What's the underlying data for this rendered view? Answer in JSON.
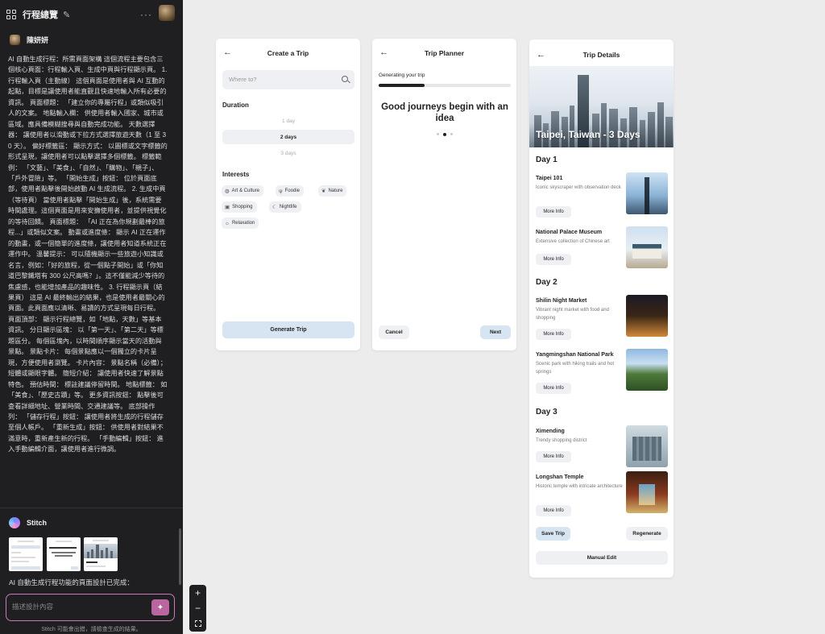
{
  "sidebar": {
    "project_title": "行程總覽",
    "user_name": "陳妍妍",
    "message": "AI 自動生成行程：所需頁面架構 這個流程主要包含三個核心頁面：行程輸入頁、生成中頁與行程顯示頁。 1. 行程輸入頁（主動線） 這個頁面是使用者與 AI 互動的起點，目標是讓使用者能直觀且快速地輸入所有必要的資訊。 頁面標題： 「建立你的專屬行程」或類似吸引人的文案。 地點輸入欄： 供使用者輸入國家、城市或區域。應具備模糊搜尋與自動完成功能。 天數選擇器： 讓使用者以滑動或下拉方式選擇旅遊天數（1 至 30 天）。 偏好標籤區： 顯示方式： 以圖標或文字標籤的形式呈現，讓使用者可以點擊選擇多個標籤。 標籤範例： 「文藝」、「美食」、「自然」、「購物」、「親子」、「戶外冒險」等。 「開始生成」按鈕： 位於頁面底部，使用者點擊後開始啟動 AI 生成流程。 2. 生成中頁（等待頁） 當使用者點擊「開始生成」後，系統需要時間處理。這個頁面是用來安撫使用者，並提供視覺化的等待回饋。 頁面標題： 「AI 正在為你規劃最棒的旅程...」或類似文案。 動畫或進度條： 顯示 AI 正在運作的動畫，或一個簡單的進度條，讓使用者知道系統正在運作中。 溫馨提示： 可以隨機顯示一些旅遊小知識或名言，例如：「好的旅程，從一個點子開始」或「你知道巴黎鐵塔有 300 公尺高嗎？」。這不僅能減少等待的焦慮感，也能增加產品的趣味性。 3. 行程顯示頁（結果頁） 這是 AI 最終輸出的結果，也是使用者最關心的頁面。此頁面應以清晰、易讀的方式呈現每日行程。 頁面頂部： 顯示行程總覽，如「地點，天數」等基本資訊。 分日顯示區塊： 以「第一天」、「第二天」等標題區分。 每個區塊內，以時間順序顯示當天的活動與景點。 景點卡片： 每個景點應以一個獨立的卡片呈現，方便使用者瀏覽。 卡片內容： 景點名稱（必備）； 短體或顯眼字體。 簡短介紹： 讓使用者快速了解景點特色。 預估時間： 標註建議停留時間。 地點標籤： 如「美食」、「歷史古蹟」等。 更多資訊按鈕： 點擊後可查看詳細地址、營業時間、交通建議等。 底部操作列： 「儲存行程」按鈕： 讓使用者將生成的行程儲存至個人帳戶。 「重新生成」按鈕： 供使用者對結果不滿意時，重新產生新的行程。 「手動編輯」按鈕： 進入手動編輯介面，讓使用者進行微調。",
    "agent_name": "Stitch",
    "done_text": "AI 自動生成行程功能的頁面設計已完成：",
    "prompt_placeholder": "描述設計內容",
    "disclaimer": "Stitch 可能會出錯，請檢查生成的結果。"
  },
  "zoom": {
    "in": "+",
    "out": "−"
  },
  "create_trip": {
    "title": "Create a Trip",
    "where_placeholder": "Where to?",
    "duration_title": "Duration",
    "durations": [
      "1 day",
      "2 days",
      "3 days"
    ],
    "selected_duration": "2 days",
    "interests_title": "Interests",
    "interests": [
      {
        "label": "Art & Culture",
        "icon": "palette-icon"
      },
      {
        "label": "Foodie",
        "icon": "fork-knife-icon"
      },
      {
        "label": "Nature",
        "icon": "leaf-icon"
      },
      {
        "label": "Shopping",
        "icon": "bag-icon"
      },
      {
        "label": "Nightlife",
        "icon": "moon-icon"
      },
      {
        "label": "Relaxation",
        "icon": "sun-icon"
      }
    ],
    "generate_label": "Generate Trip"
  },
  "trip_planner": {
    "title": "Trip Planner",
    "generating_label": "Generating your trip",
    "progress": 0.35,
    "quote": "Good journeys begin with an idea",
    "active_dot": 2,
    "cancel_label": "Cancel",
    "next_label": "Next"
  },
  "trip_details": {
    "title": "Trip Details",
    "hero_title": "Taipei, Taiwan - 3 Days",
    "days": [
      {
        "title": "Day 1",
        "places": [
          {
            "name": "Taipei 101",
            "desc": "Iconic skyscraper with observation deck",
            "more": "More Info"
          },
          {
            "name": "National Palace Museum",
            "desc": "Extensive collection of Chinese art",
            "more": "More Info"
          }
        ]
      },
      {
        "title": "Day 2",
        "places": [
          {
            "name": "Shilin Night Market",
            "desc": "Vibrant night market with food and shopping",
            "more": "More Info"
          },
          {
            "name": "Yangmingshan National Park",
            "desc": "Scenic park with hiking trails and hot springs",
            "more": "More Info"
          }
        ]
      },
      {
        "title": "Day 3",
        "places": [
          {
            "name": "Ximending",
            "desc": "Trendy shopping district",
            "more": "More Info"
          },
          {
            "name": "Longshan Temple",
            "desc": "Historic temple with intricate architecture",
            "more": "More Info"
          }
        ]
      }
    ],
    "save_label": "Save Trip",
    "regenerate_label": "Regenerate",
    "manual_label": "Manual Edit"
  }
}
